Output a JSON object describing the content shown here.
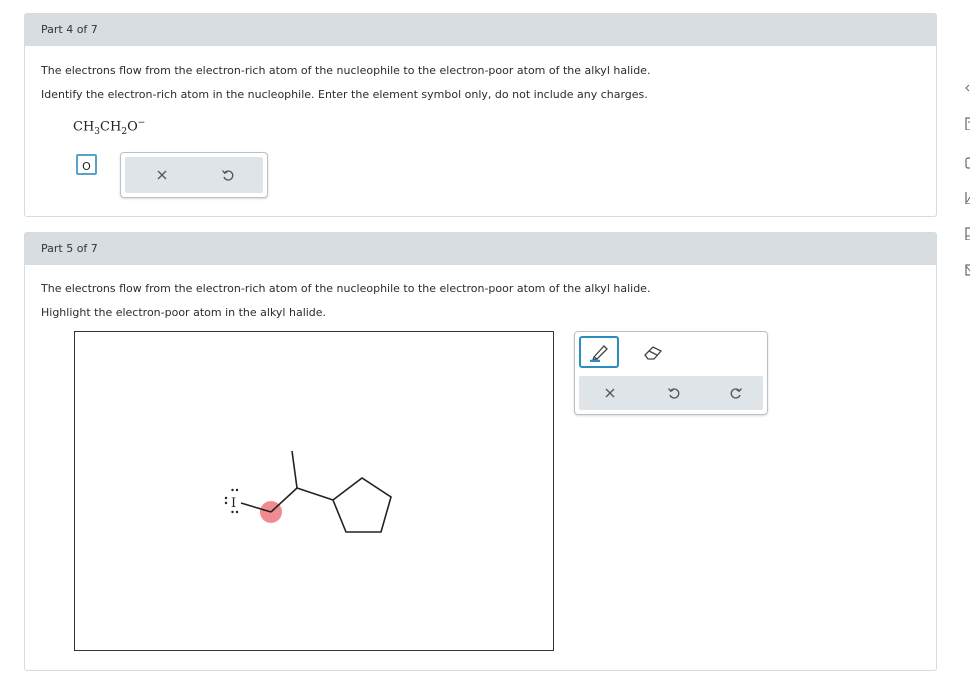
{
  "part4": {
    "header": "Part 4 of 7",
    "line1": "The electrons flow from the electron-rich atom of the nucleophile to the electron-poor atom of the alkyl halide.",
    "line2": "Identify the electron-rich atom in the nucleophile. Enter the element symbol only, do not include any charges.",
    "formula": {
      "a": "CH",
      "sub1": "3",
      "b": "CH",
      "sub2": "2",
      "c": "O",
      "charge": "−"
    },
    "answer": "O"
  },
  "part5": {
    "header": "Part 5 of 7",
    "line1": "The electrons flow from the electron-rich atom of the nucleophile to the electron-poor atom of the alkyl halide.",
    "line2": "Highlight the electron-poor atom in the alkyl halide.",
    "halogen_label": "I",
    "highlight_color": "#ee7f85"
  },
  "icons": {
    "clear": "close-icon",
    "undo": "undo-icon",
    "redo": "redo-icon",
    "pencil": "pencil-icon",
    "eraser": "eraser-icon"
  },
  "colors": {
    "accent": "#2a8fbf",
    "header_bg": "#d8dde2"
  }
}
